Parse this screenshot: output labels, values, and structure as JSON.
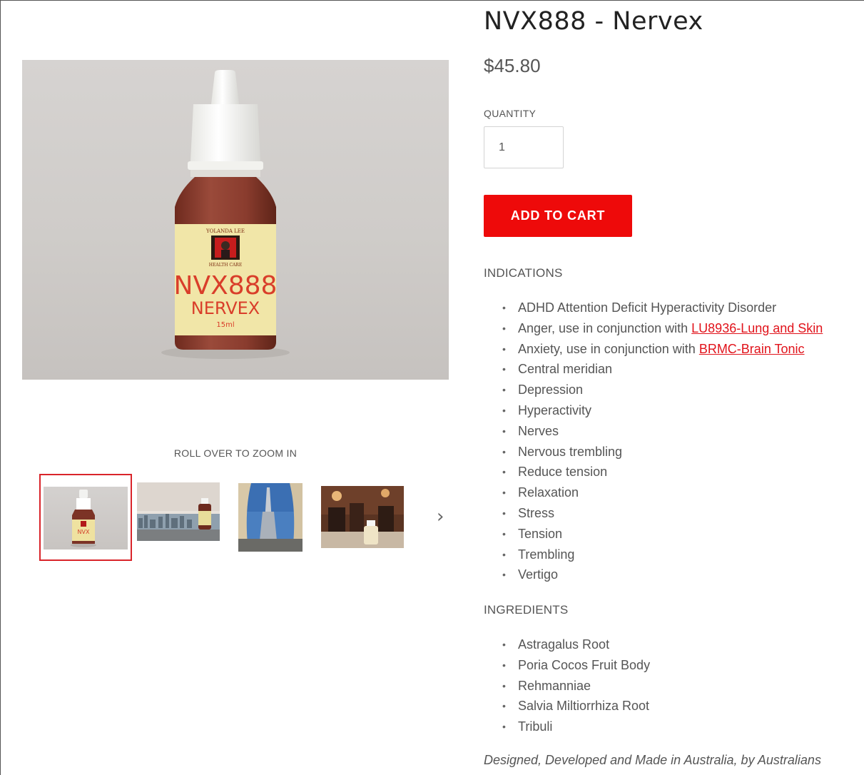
{
  "product": {
    "title": "NVX888 - Nervex",
    "price": "$45.80",
    "quantity_label": "QUANTITY",
    "quantity_value": "1",
    "add_to_cart_label": "ADD TO CART",
    "bottle_label": {
      "brand_top": "YOLANDA LEE",
      "brand_bottom": "HEALTH CARE",
      "code": "NVX888",
      "name": "NERVEX",
      "volume": "15ml"
    }
  },
  "gallery": {
    "zoom_hint": "ROLL OVER TO ZOOM IN",
    "selected_index": 0,
    "thumbnails": [
      "bottle",
      "city-skyline",
      "tower",
      "restaurant"
    ],
    "next_icon": "chevron-right-icon",
    "active_border_color": "#d9242a"
  },
  "indications": {
    "heading": "INDICATIONS",
    "items": [
      {
        "text": "ADHD Attention Deficit Hyperactivity Disorder"
      },
      {
        "text": "Anger, use in conjunction with ",
        "link": "LU8936-Lung and Skin"
      },
      {
        "text": "Anxiety, use in conjunction with ",
        "link": "BRMC-Brain Tonic"
      },
      {
        "text": "Central meridian"
      },
      {
        "text": "Depression"
      },
      {
        "text": "Hyperactivity"
      },
      {
        "text": "Nerves"
      },
      {
        "text": "Nervous trembling"
      },
      {
        "text": "Reduce tension"
      },
      {
        "text": "Relaxation"
      },
      {
        "text": "Stress"
      },
      {
        "text": "Tension"
      },
      {
        "text": "Trembling"
      },
      {
        "text": "Vertigo"
      }
    ]
  },
  "ingredients": {
    "heading": "INGREDIENTS",
    "items": [
      "Astragalus Root",
      "Poria Cocos Fruit Body",
      "Rehmanniae",
      "Salvia Miltiorrhiza Root",
      "Tribuli"
    ]
  },
  "tagline": "Designed, Developed and Made in Australia, by Australians",
  "colors": {
    "accent": "#ee0a0a",
    "link": "#e1131b",
    "text": "#555555",
    "title": "#222222"
  }
}
